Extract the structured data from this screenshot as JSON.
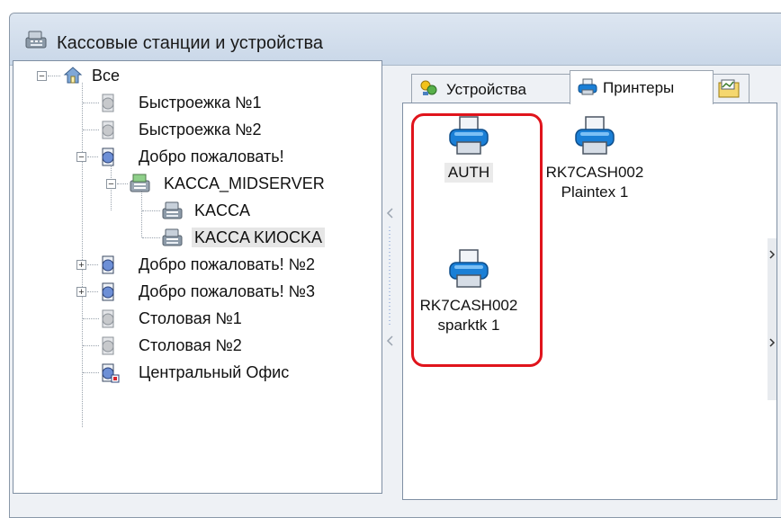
{
  "window": {
    "title": "Кассовые станции и устройства"
  },
  "tree": {
    "root": "Все",
    "items": [
      "Быстроежка №1",
      "Быстроежка №2",
      "Добро пожаловать!",
      "KACCA_MIDSERVER",
      "KACCA",
      "KACCA KИOCKA",
      "Добро пожаловать! №2",
      "Добро пожаловать! №3",
      "Столовая №1",
      "Столовая №2",
      "Центральный Офис"
    ],
    "selected": "KACCA KИOCKA"
  },
  "tabs": [
    {
      "label": "Устройства",
      "active": false
    },
    {
      "label": "Принтеры",
      "active": true
    }
  ],
  "printers": [
    {
      "line1": "AUTH",
      "line2": ""
    },
    {
      "line1": "RK7CASH002",
      "line2": "Plaintex 1"
    },
    {
      "line1": "RK7CASH002",
      "line2": "sparktk 1"
    }
  ],
  "colors": {
    "highlight": "#e0141c",
    "printer_blue": "#1a7fd6"
  }
}
